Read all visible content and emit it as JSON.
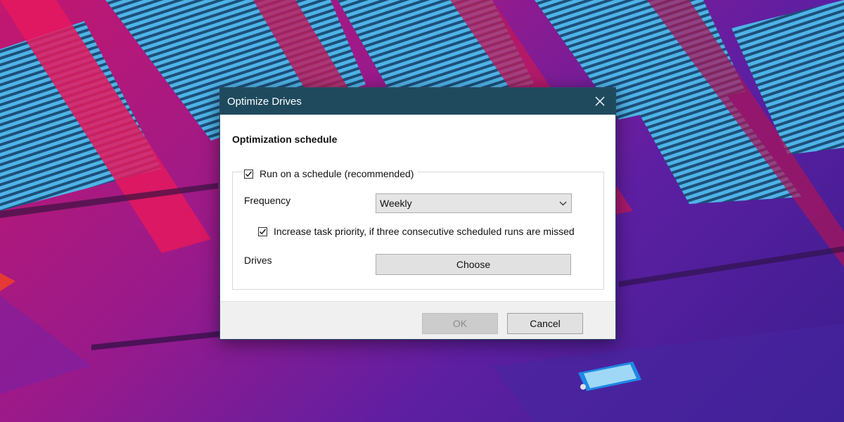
{
  "dialog": {
    "title": "Optimize Drives",
    "section_heading": "Optimization schedule",
    "schedule_checkbox": {
      "label": "Run on a schedule (recommended)",
      "checked": true
    },
    "frequency": {
      "label": "Frequency",
      "selected": "Weekly"
    },
    "priority_checkbox": {
      "label": "Increase task priority, if three consecutive scheduled runs are missed",
      "checked": true
    },
    "drives": {
      "label": "Drives",
      "button_label": "Choose"
    },
    "ok_label": "OK",
    "cancel_label": "Cancel"
  },
  "icons": {
    "close": "close-icon",
    "checkmark": "checkmark-icon",
    "dropdown": "chevron-down-icon"
  },
  "colors": {
    "titlebar": "#1f4a5e",
    "wallpaper_primary": "#c2186f",
    "wallpaper_secondary": "#5d1fa2",
    "wallpaper_window": "#3fa8d8"
  }
}
